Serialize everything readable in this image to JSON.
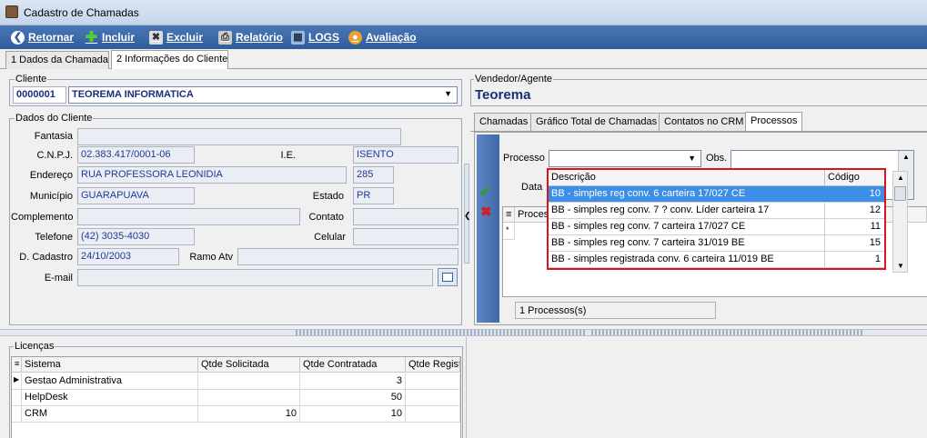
{
  "window": {
    "title": "Cadastro de Chamadas"
  },
  "toolbar": {
    "retornar": "Retornar",
    "incluir": "Incluir",
    "excluir": "Excluir",
    "relatorio": "Relatório",
    "logs": "LOGS",
    "avaliacao": "Avaliação"
  },
  "tabs": [
    "1 Dados da Chamada",
    "2 Informações do Cliente"
  ],
  "cliente": {
    "label": "Cliente",
    "codigo": "0000001",
    "nome": "TEOREMA INFORMATICA"
  },
  "vendedor": {
    "label": "Vendedor/Agente",
    "nome": "Teorema"
  },
  "dados": {
    "label": "Dados do Cliente",
    "fantasia_label": "Fantasia",
    "fantasia": "",
    "cnpj_label": "C.N.P.J.",
    "cnpj": "02.383.417/0001-06",
    "ie_label": "I.E.",
    "ie": "ISENTO",
    "endereco_label": "Endereço",
    "endereco": "RUA PROFESSORA LEONIDIA",
    "numero": "285",
    "municipio_label": "Município",
    "municipio": "GUARAPUAVA",
    "estado_label": "Estado",
    "estado": "PR",
    "complemento_label": "Complemento",
    "complemento": "",
    "contato_label": "Contato",
    "contato": "",
    "telefone_label": "Telefone",
    "telefone": "(42) 3035-4030",
    "celular_label": "Celular",
    "celular": "",
    "dcadastro_label": "D. Cadastro",
    "dcadastro": "24/10/2003",
    "ramo_label": "Ramo Atv",
    "ramo": "",
    "email_label": "E-mail",
    "email": ""
  },
  "subtabs": [
    "Chamadas",
    "Gráfico Total de Chamadas",
    "Contatos no CRM",
    "Processos"
  ],
  "processos": {
    "processo_label": "Processo",
    "processo_value": "",
    "obs_label": "Obs.",
    "data_label": "Data",
    "grid_header": "Process",
    "footer": "1 Processos(s)",
    "dropdown": {
      "headers": [
        "Descrição",
        "Código"
      ],
      "rows": [
        {
          "descricao": "BB - simples reg conv. 6 carteira 17/027 CE",
          "codigo": "10"
        },
        {
          "descricao": "BB - simples reg conv. 7 ? conv. Líder carteira 17",
          "codigo": "12"
        },
        {
          "descricao": "BB - simples reg conv. 7 carteira 17/027 CE",
          "codigo": "11"
        },
        {
          "descricao": "BB - simples reg conv. 7 carteira 31/019 BE",
          "codigo": "15"
        },
        {
          "descricao": "BB - simples registrada conv. 6 carteira 11/019 BE",
          "codigo": "1"
        }
      ]
    }
  },
  "licencas": {
    "label": "Licenças",
    "headers": [
      "Sistema",
      "Qtde Solicitada",
      "Qtde Contratada",
      "Qtde Regist"
    ],
    "rows": [
      {
        "sistema": "Gestao Administrativa",
        "solicitada": "",
        "contratada": "3",
        "registrada": ""
      },
      {
        "sistema": "HelpDesk",
        "solicitada": "",
        "contratada": "50",
        "registrada": ""
      },
      {
        "sistema": "CRM",
        "solicitada": "10",
        "contratada": "10",
        "registrada": ""
      }
    ]
  },
  "colors": {
    "toolbar": "#2f5d9b",
    "highlight": "#3d8ee6",
    "dropdown_border": "#d8141e",
    "field_text": "#1f3a93"
  }
}
